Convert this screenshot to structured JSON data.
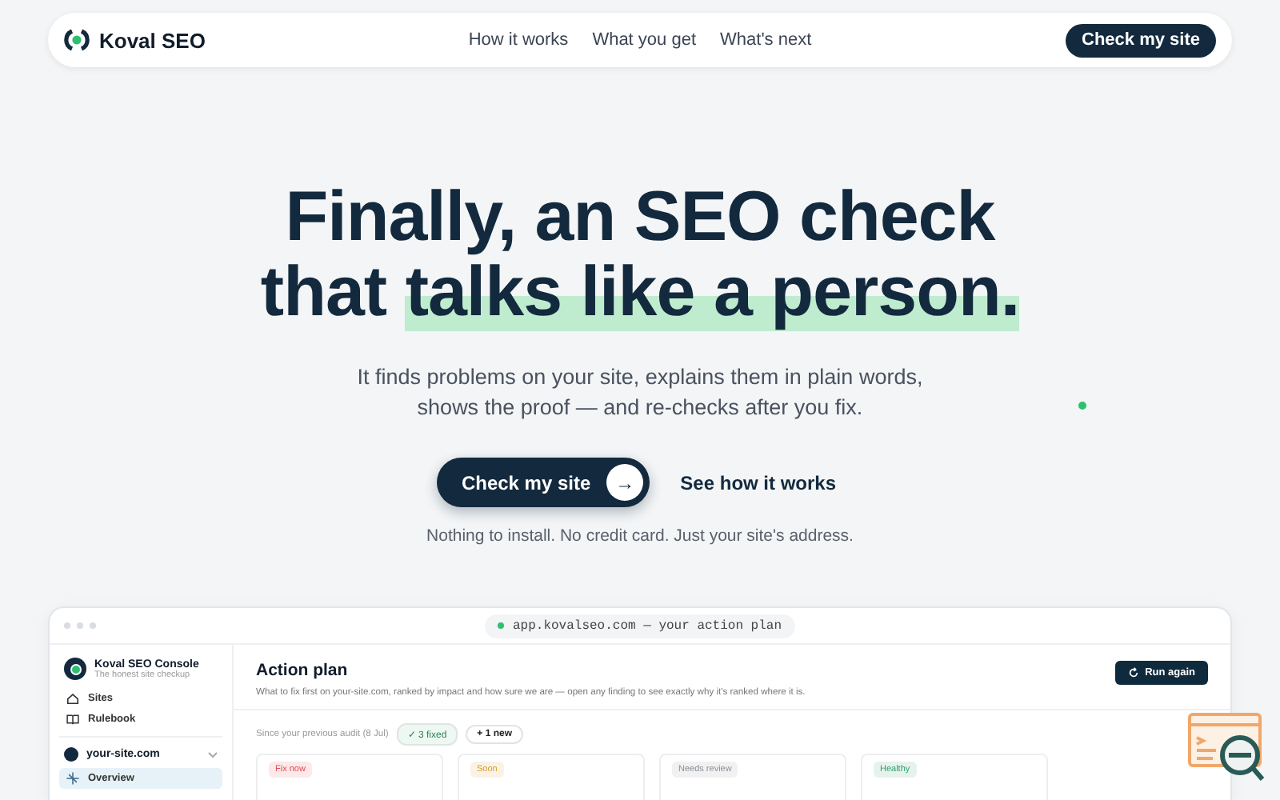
{
  "nav": {
    "brand": "Koval SEO",
    "links": [
      "How it works",
      "What you get",
      "What's next"
    ],
    "cta": "Check my site"
  },
  "hero": {
    "title_line_1": "Finally, an SEO check",
    "title_line_2": "that",
    "title_highlight": "talks like a person.",
    "subtitle_line_1": "It finds problems on your site, explains them in plain words,",
    "subtitle_line_2": "shows the proof — and re-checks after you fix.",
    "primary_button": "Check my site",
    "arrow": "→",
    "secondary_link": "See how it works",
    "note": "Nothing to install. No credit card. Just your site's address."
  },
  "app": {
    "url": "app.kovalseo.com — your action plan",
    "sidebar": {
      "title": "Koval SEO Console",
      "tagline": "The honest site checkup",
      "items": [
        {
          "label": "Sites",
          "selected": false
        },
        {
          "label": "Rulebook",
          "selected": false
        }
      ],
      "site": "your-site.com",
      "site_items": [
        {
          "label": "Overview",
          "selected": true
        }
      ]
    },
    "header": {
      "title": "Action plan",
      "description": "What to fix first on your-site.com, ranked by impact and how sure we are — open any finding to see exactly why it's ranked where it is.",
      "button": "Run again"
    },
    "since": "Since your previous audit (8 Jul)",
    "chips": [
      {
        "kind": "fixed",
        "label": "✓ 3 fixed"
      },
      {
        "kind": "new",
        "label": "+ 1 new"
      }
    ],
    "cards": [
      {
        "badge": "Fix now",
        "color": "#e5484d"
      },
      {
        "badge": "Soon",
        "color": "#d99a2b"
      },
      {
        "badge": "Needs review",
        "color": "#8a8f98"
      },
      {
        "badge": "Healthy",
        "color": "#2f9e6b"
      }
    ]
  }
}
